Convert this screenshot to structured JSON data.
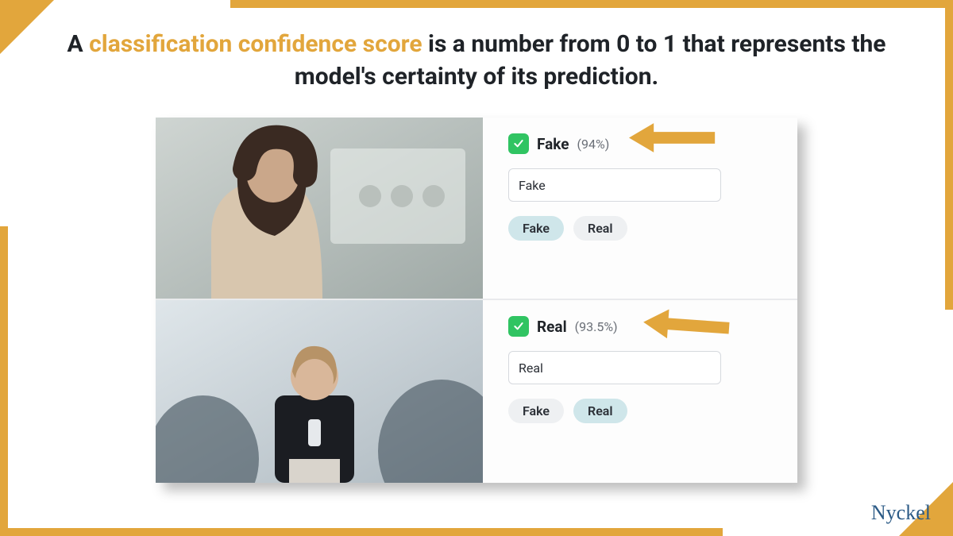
{
  "headline": {
    "lead": "A ",
    "accent": "classification confidence score",
    "tail": " is a number from 0 to 1 that represents the model's certainty of its prediction."
  },
  "rows": [
    {
      "prediction_label": "Fake",
      "confidence_text": "(94%)",
      "input_value": "Fake",
      "chips": [
        "Fake",
        "Real"
      ],
      "active_chip": "Fake"
    },
    {
      "prediction_label": "Real",
      "confidence_text": "(93.5%)",
      "input_value": "Real",
      "chips": [
        "Fake",
        "Real"
      ],
      "active_chip": "Real"
    }
  ],
  "brand": "Nyckel",
  "colors": {
    "accent": "#e2a63c",
    "check": "#30c462",
    "brand": "#2b5a86"
  }
}
